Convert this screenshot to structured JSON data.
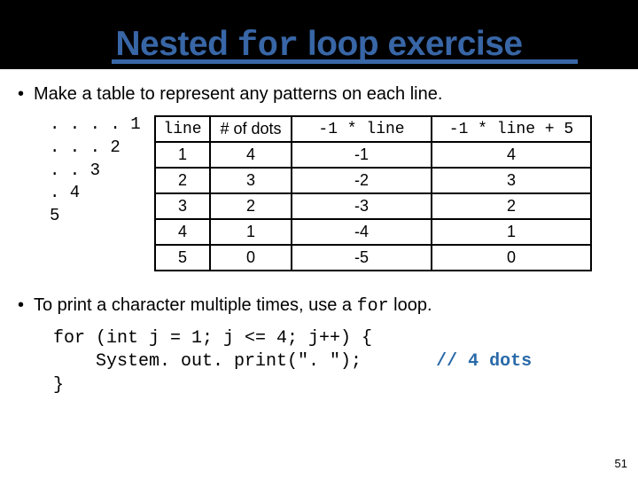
{
  "title": {
    "pre": "Nested ",
    "kw": "for",
    "post": " loop exercise"
  },
  "bullet1": "Make a table to represent any patterns on each line.",
  "pattern_lines": ". . . . 1\n. . . 2\n. . 3\n. 4\n5",
  "table": {
    "headers": {
      "h1": "line",
      "h2": "# of dots",
      "h3": "-1 * line",
      "h4": "-1 * line + 5"
    },
    "rows": [
      {
        "a": "1",
        "b": "4",
        "c": "-1",
        "d": "4"
      },
      {
        "a": "2",
        "b": "3",
        "c": "-2",
        "d": "3"
      },
      {
        "a": "3",
        "b": "2",
        "c": "-3",
        "d": "2"
      },
      {
        "a": "4",
        "b": "1",
        "c": "-4",
        "d": "1"
      },
      {
        "a": "5",
        "b": "0",
        "c": "-5",
        "d": "0"
      }
    ]
  },
  "bullet2": {
    "pre": "To print a character multiple times, use a ",
    "kw": "for",
    "post": " loop."
  },
  "code": {
    "l1": "for (int j = 1; j <= 4; j++) {",
    "l2_indent": "    System. out. print(\". \");       ",
    "l2_cmt": "// 4 dots",
    "l3": "}"
  },
  "page": "51",
  "chart_data": {
    "type": "table",
    "columns": [
      "line",
      "# of dots",
      "-1 * line",
      "-1 * line + 5"
    ],
    "rows": [
      [
        1,
        4,
        -1,
        4
      ],
      [
        2,
        3,
        -2,
        3
      ],
      [
        3,
        2,
        -3,
        2
      ],
      [
        4,
        1,
        -4,
        1
      ],
      [
        5,
        0,
        -5,
        0
      ]
    ]
  }
}
